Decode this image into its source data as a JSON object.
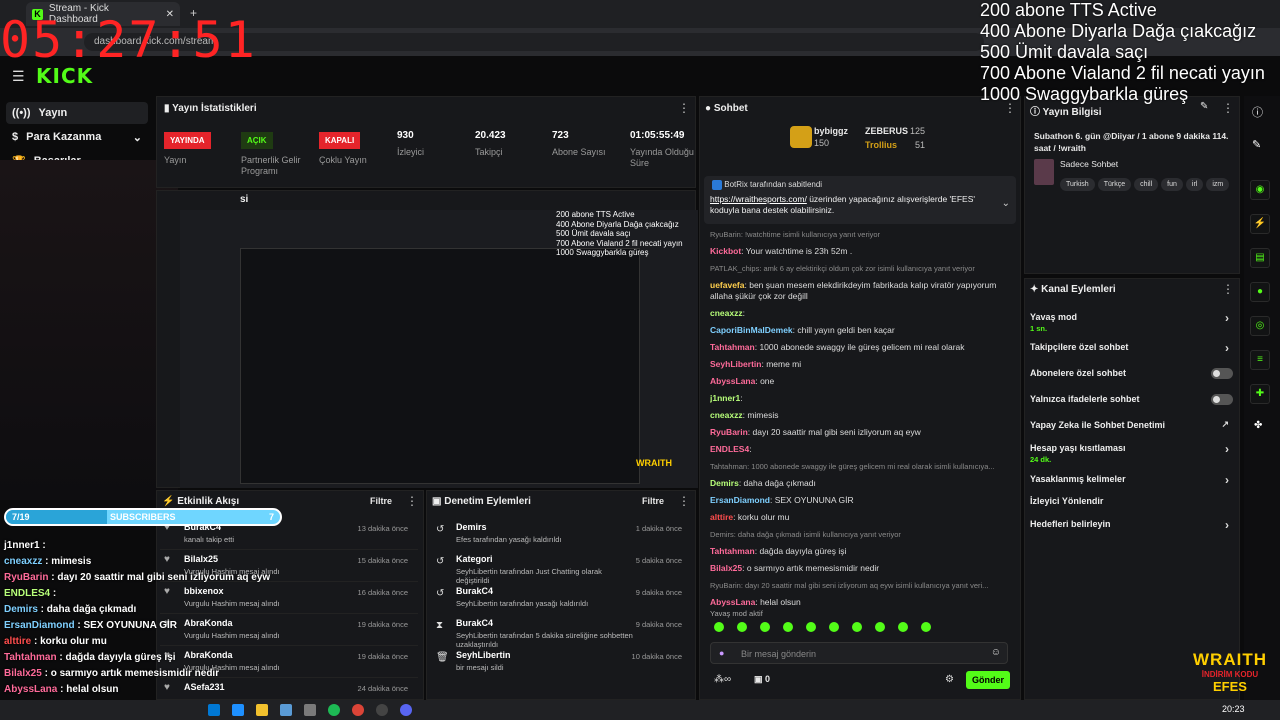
{
  "browser": {
    "tab_title": "Stream - Kick Dashboard",
    "url": "dashboard.kick.com/stream"
  },
  "overlay": {
    "clock": "05:27:51",
    "goals": [
      "200 abone TTS Active",
      "400 Abone Diyarla Dağa çıakcağız",
      "500 Ümit davala saçı",
      "700 Abone Vialand 2 fil necati yayın",
      "1000 Swaggybarkla güreş"
    ],
    "subscribers_bar": {
      "left": "7/19",
      "label": "SUBSCRIBERS",
      "right": "7",
      "progress": 0.37
    },
    "chat_lines": [
      {
        "user": "j1nner1",
        "text": " : "
      },
      {
        "user": "cneaxzz",
        "text": " : mimesis"
      },
      {
        "user": "RyuBarin",
        "text": " : dayı 20 saattir mal gibi seni izliyorum aq eyw"
      },
      {
        "user": "ENDLES4",
        "text": " : "
      },
      {
        "user": "Demirs",
        "text": " : daha dağa çıkmadı"
      },
      {
        "user": "ErsanDiamond",
        "text": " : SEX OYUNUNA GİR"
      },
      {
        "user": "alttire",
        "text": " : korku olur mu"
      },
      {
        "user": "Tahtahman",
        "text": " : dağda dayıyla güreş işi"
      },
      {
        "user": "Bilalx25",
        "text": " : o sarmıyo artık memesismidir nedir"
      },
      {
        "user": "AbyssLana",
        "text": " : helal olsun"
      }
    ],
    "brand": "WRAITH",
    "brand_sub": "İNDİRİM KODU",
    "brand_code": "EFES"
  },
  "sidebar": {
    "logo": "KICK",
    "items": [
      {
        "label": "Yayın"
      },
      {
        "label": "Para Kazanma"
      },
      {
        "label": "Başarılar"
      }
    ]
  },
  "stats": {
    "title": "Yayın İstatistikleri",
    "items": [
      {
        "badge": "YAYINDA",
        "label": "Yayın",
        "color": "#e5242b"
      },
      {
        "badge": "AÇIK",
        "label": "Partnerlik Gelir Programı",
        "color": "#53fc18"
      },
      {
        "badge": "KAPALI",
        "label": "Çoklu Yayın",
        "color": "#e5242b"
      },
      {
        "value": "930",
        "label": "İzleyici"
      },
      {
        "value": "20.423",
        "label": "Takipçi"
      },
      {
        "value": "723",
        "label": "Abone Sayısı"
      },
      {
        "value": "01:05:55:49",
        "label": "Yayında Olduğu Süre"
      }
    ]
  },
  "preview_title": "si",
  "activity": {
    "title": "Etkinlik Akışı",
    "filter": "Filtre",
    "items": [
      {
        "name": "BurakC4",
        "sub": "kanalı takip etti",
        "time": "13 dakika önce"
      },
      {
        "name": "Bilalx25",
        "sub": "Vurgulu Hashim mesaj alındı",
        "time": "15 dakika önce"
      },
      {
        "name": "bbixenox",
        "sub": "Vurgulu Hashim mesaj alındı",
        "time": "16 dakika önce"
      },
      {
        "name": "AbraKonda",
        "sub": "Vurgulu Hashim mesaj alındı",
        "time": "19 dakika önce"
      },
      {
        "name": "AbraKonda",
        "sub": "Vurgulu Hashim mesaj alındı",
        "time": "19 dakika önce"
      },
      {
        "name": "ASefa231",
        "sub": "",
        "time": "24 dakika önce"
      }
    ]
  },
  "moderation": {
    "title": "Denetim Eylemleri",
    "filter": "Filtre",
    "items": [
      {
        "name": "Demirs",
        "sub": "Efes tarafından yasağı kaldırıldı",
        "time": "1 dakika önce"
      },
      {
        "name": "Kategori",
        "sub": "SeyhLibertin tarafından Just Chatting olarak değiştirildi",
        "time": "5 dakika önce"
      },
      {
        "name": "BurakC4",
        "sub": "SeyhLibertin tarafından yasağı kaldırıldı",
        "time": "9 dakika önce"
      },
      {
        "name": "BurakC4",
        "sub": "SeyhLibertin tarafından 5 dakika süreliğine sohbetten uzaklaştırıldı",
        "time": "9 dakika önce"
      },
      {
        "name": "SeyhLibertin",
        "sub": "bir mesajı sildi",
        "time": "10 dakika önce"
      }
    ]
  },
  "chat": {
    "title": "Sohbet",
    "top_users": [
      {
        "name": "bybiggz",
        "count": "150"
      },
      {
        "name": "ZEBERUS",
        "count": "125"
      },
      {
        "name": "Trollius",
        "count": "51"
      }
    ],
    "pinned_by": "BotRix tarafından sabitlendi",
    "pinned_link": "https://wraithesports.com/",
    "pinned_text": " üzerinden yapacağınız alışverişlerde 'EFES' koduyla bana destek olabilirsiniz.",
    "messages": [
      {
        "sys": "RyuBarin: !watchtime isimli kullanıcıya yanıt veriyor"
      },
      {
        "user": "Kickbot",
        "text": ": Your watchtime is 23h 52m .",
        "cls": "u1"
      },
      {
        "sys": "PATLAK_chips: amk 6 ay elektirikçi oldum çok zor isimli kullanıcıya yanıt veriyor"
      },
      {
        "user": "uefavefa",
        "text": ": ben şuan mesem elekdirikdeyim fabrikada kalıp viratör yapıyorum allaha şükür çok zor değill",
        "cls": "u3"
      },
      {
        "user": "cneaxzz",
        "text": ":",
        "cls": "u4"
      },
      {
        "user": "CaporiBinMalDemek",
        "text": ": chill yayın geldi ben kaçar",
        "cls": "u2"
      },
      {
        "user": "Tahtahman",
        "text": ": 1000 abonede swaggy ile güreş gelicem mi real olarak",
        "cls": "u1"
      },
      {
        "user": "SeyhLibertin",
        "text": ": meme mi",
        "cls": "u1"
      },
      {
        "user": "AbyssLana",
        "text": ": one",
        "cls": "u1"
      },
      {
        "user": "j1nner1",
        "text": ":",
        "cls": "u4"
      },
      {
        "user": "cneaxzz",
        "text": ": mimesis",
        "cls": "u4"
      },
      {
        "user": "RyuBarin",
        "text": ": dayı 20 saattir mal gibi seni izliyorum aq eyw",
        "cls": "u1"
      },
      {
        "user": "ENDLES4",
        "text": ":",
        "cls": "u1"
      },
      {
        "sys": "Tahtahman: 1000 abonede swaggy ile güreş gelicem mi real olarak isimli kullanıcıya..."
      },
      {
        "user": "Demirs",
        "text": ": daha dağa çıkmadı",
        "cls": "u4"
      },
      {
        "user": "ErsanDiamond",
        "text": ": SEX OYUNUNA GİR",
        "cls": "u2"
      },
      {
        "user": "alttire",
        "text": ": korku olur mu",
        "cls": "u5"
      },
      {
        "sys": "Demirs: daha dağa çıkmadı isimli kullanıcıya yanıt veriyor"
      },
      {
        "user": "Tahtahman",
        "text": ": dağda dayıyla güreş işi",
        "cls": "u1"
      },
      {
        "user": "Bilalx25",
        "text": ": o sarmıyo artık memesismidir nedir",
        "cls": "u1"
      },
      {
        "sys": "RyuBarin: dayı 20 saattir mal gibi seni izliyorum aq eyw isimli kullanıcıya yanıt veri..."
      },
      {
        "user": "AbyssLana",
        "text": ": helal olsun",
        "cls": "u1"
      }
    ],
    "slow_mode": "Yavaş mod aktif",
    "placeholder": "Bir mesaj gönderin",
    "counter": "0",
    "send": "Gönder"
  },
  "stream_info": {
    "title": "Yayın Bilgisi",
    "text": "Subathon 6. gün @Diiyar / 1 abone 9 dakika 114. saat / !wraith",
    "category": "Sadece Sohbet",
    "tags": [
      "Turkish",
      "Türkçe",
      "chill",
      "fun",
      "irl",
      "izm"
    ]
  },
  "channel_actions": {
    "title": "Kanal Eylemleri",
    "items": [
      {
        "label": "Yavaş mod",
        "sub": "1 sn.",
        "type": "chev"
      },
      {
        "label": "Takipçilere özel sohbet",
        "type": "chev"
      },
      {
        "label": "Abonelere özel sohbet",
        "type": "toggle"
      },
      {
        "label": "Yalnızca ifadelerle sohbet",
        "type": "toggle"
      },
      {
        "label": "Yapay Zeka ile Sohbet Denetimi",
        "type": "ext"
      },
      {
        "label": "Hesap yaşı kısıtlaması",
        "sub": "24 dk.",
        "type": "chev"
      },
      {
        "label": "Yasaklanmış kelimeler",
        "type": "chev"
      },
      {
        "label": "İzleyici Yönlendir",
        "type": "none"
      },
      {
        "label": "Hedefleri belirleyin",
        "type": "chev"
      }
    ]
  },
  "taskbar": {
    "time": "20:23"
  }
}
